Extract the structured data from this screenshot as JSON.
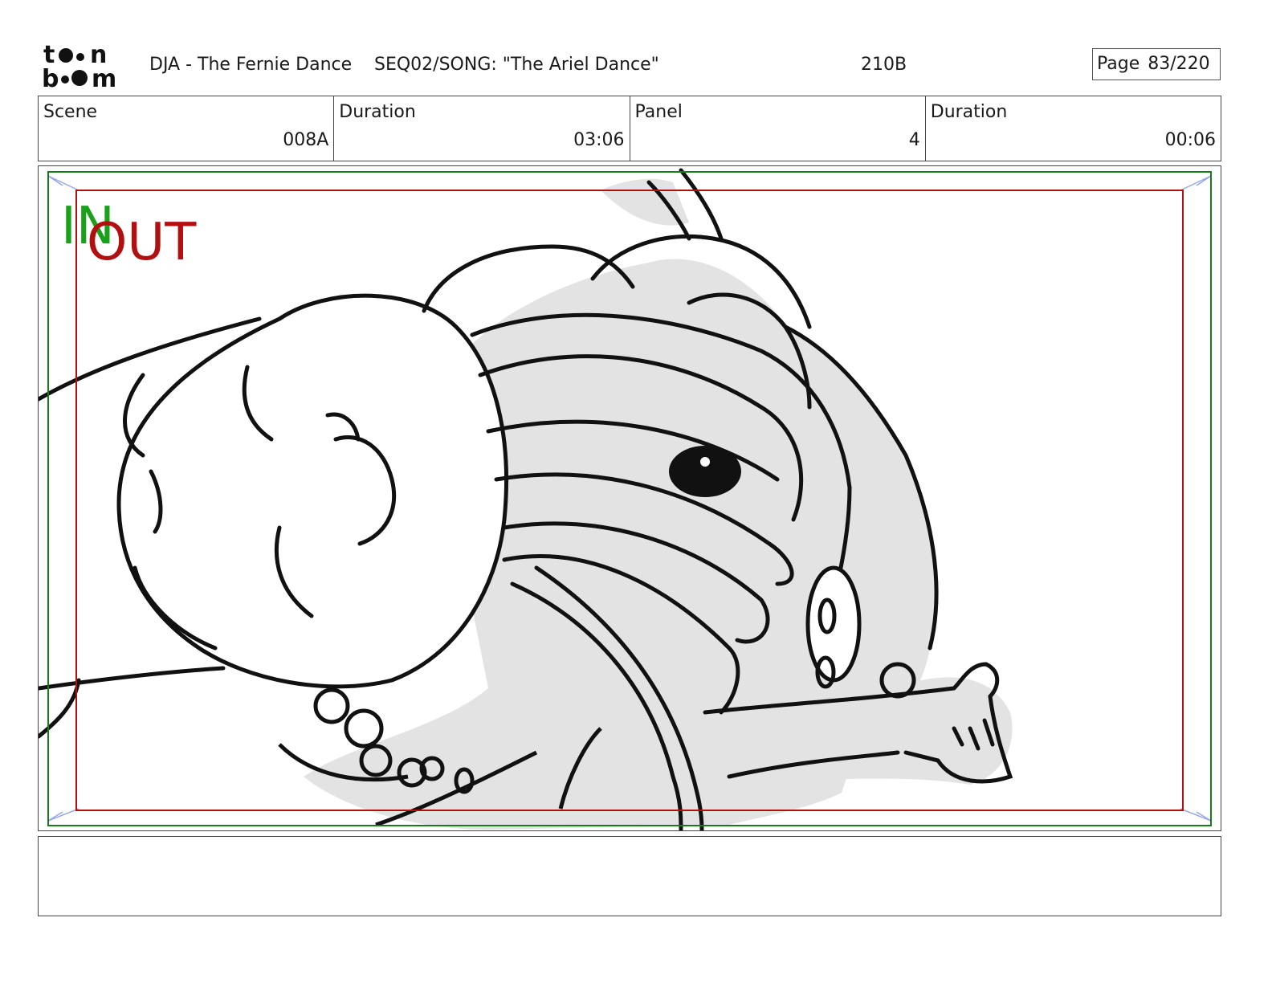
{
  "header": {
    "logo_text": "toon boom",
    "title": "DJA - The Fernie Dance",
    "sequence": "SEQ02/SONG: \"The Ariel Dance\"",
    "scene_code": "210B",
    "page_label": "Page",
    "page_number": "83/220"
  },
  "info": [
    {
      "label": "Scene",
      "value": "008A"
    },
    {
      "label": "Duration",
      "value": "03:06"
    },
    {
      "label": "Panel",
      "value": "4"
    },
    {
      "label": "Duration",
      "value": "00:06"
    }
  ],
  "panel": {
    "in_label": "IN",
    "out_label": "OUT",
    "in_color": "#1aa01a",
    "out_color": "#b01010",
    "safe_frame_color": "#1a7a1a",
    "action_frame_color": "#b01010"
  },
  "notes": {
    "text": ""
  }
}
